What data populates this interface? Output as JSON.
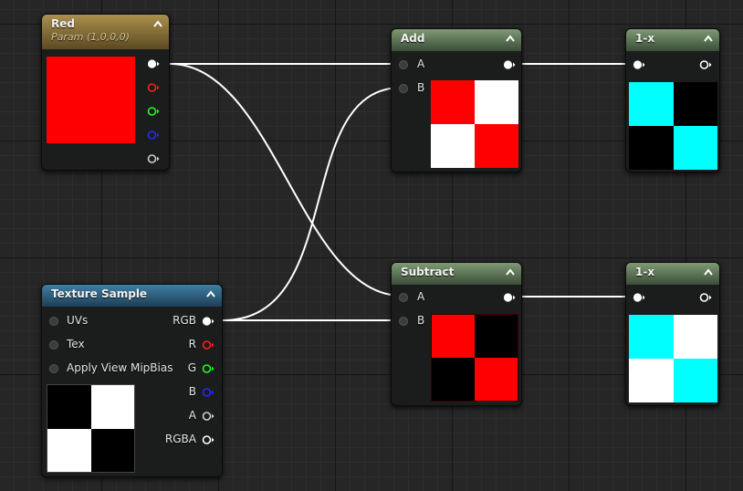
{
  "nodes": {
    "red": {
      "title": "Red",
      "subtitle": "Param (1,0,0,0)",
      "preview_color": "#ff0000",
      "outputs": [
        "rgb",
        "r",
        "g",
        "b",
        "a"
      ]
    },
    "texture": {
      "title": "Texture Sample",
      "inputs": [
        "UVs",
        "Tex",
        "Apply View MipBias"
      ],
      "outputs": [
        "RGB",
        "R",
        "G",
        "B",
        "A",
        "RGBA"
      ],
      "preview": [
        "#000000",
        "#ffffff",
        "#ffffff",
        "#000000"
      ]
    },
    "add": {
      "title": "Add",
      "inputs": [
        "A",
        "B"
      ],
      "preview": [
        "#ff0000",
        "#ffffff",
        "#ffffff",
        "#ff0000"
      ]
    },
    "subtract": {
      "title": "Subtract",
      "inputs": [
        "A",
        "B"
      ],
      "preview": [
        "#ff0000",
        "#000000",
        "#000000",
        "#ff0000"
      ]
    },
    "oneminus_top": {
      "title": "1-x",
      "preview": [
        "#00ffff",
        "#000000",
        "#000000",
        "#00ffff"
      ]
    },
    "oneminus_bottom": {
      "title": "1-x",
      "preview": [
        "#00ffff",
        "#ffffff",
        "#ffffff",
        "#00ffff"
      ]
    }
  },
  "pin_colors": {
    "white": "#ffffff",
    "red": "#ff1e1e",
    "green": "#1eff1e",
    "blue": "#2828ff",
    "alpha": "#cfcfcf",
    "input_gray": "#6a6a6a"
  },
  "icons": {
    "collapse": "chevron-up-icon",
    "connected_pin": "exec-pin-filled-icon",
    "open_pin": "exec-pin-hollow-icon",
    "input_pin": "circle-pin-icon"
  }
}
